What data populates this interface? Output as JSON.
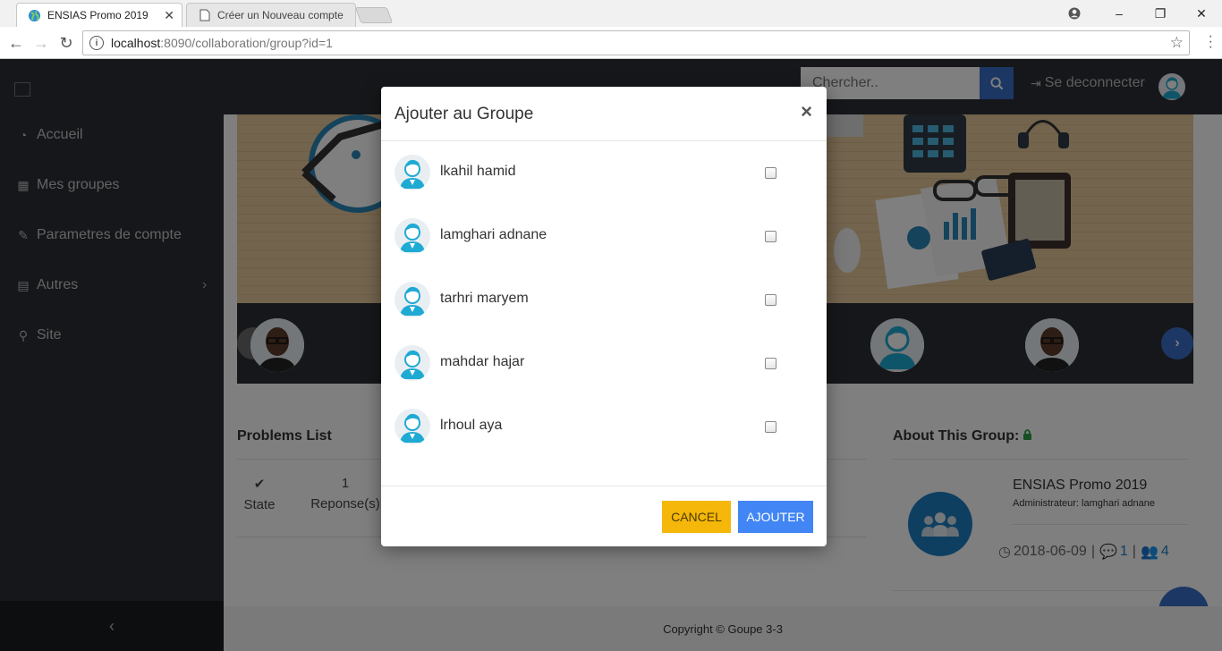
{
  "browser": {
    "tabs": [
      {
        "title": "ENSIAS Promo 2019",
        "active": true
      },
      {
        "title": "Créer un Nouveau compte",
        "active": false
      }
    ],
    "url_host": "localhost",
    "url_path": ":8090/collaboration/group?id=1"
  },
  "sidebar": {
    "items": [
      {
        "label": "Accueil",
        "icon": "dashboard-icon"
      },
      {
        "label": "Mes groupes",
        "icon": "table-icon"
      },
      {
        "label": "Parametres de compte",
        "icon": "wrench-icon"
      },
      {
        "label": "Autres",
        "icon": "file-icon"
      },
      {
        "label": "Site",
        "icon": "link-icon"
      }
    ],
    "collapse_glyph": "‹"
  },
  "topbar": {
    "search_placeholder": "Chercher..",
    "logout_label": "Se deconnecter"
  },
  "problems": {
    "title": "Problems List",
    "state_label": "State",
    "responses_value": "1",
    "responses_label": "Reponse(s)"
  },
  "about": {
    "title": "About This Group:",
    "group_name": "ENSIAS Promo 2019",
    "admin_line": "Administrateur: lamghari adnane",
    "date": "2018-06-09",
    "comments": "1",
    "members": "4"
  },
  "footer": {
    "copyright": "Copyright © Goupe 3-3"
  },
  "modal": {
    "title": "Ajouter au Groupe",
    "close_glyph": "×",
    "members": [
      {
        "name": "lkahil hamid",
        "checked": false
      },
      {
        "name": "lamghari adnane",
        "checked": false
      },
      {
        "name": "tarhri maryem",
        "checked": false
      },
      {
        "name": "mahdar hajar",
        "checked": false
      },
      {
        "name": "lrhoul aya",
        "checked": false
      }
    ],
    "cancel_label": "CANCEL",
    "add_label": "AJOUTER"
  },
  "colors": {
    "accent_blue": "#4285f4",
    "cancel_yellow": "#f5b70a",
    "sidebar_bg": "#2b2f34",
    "avatar_cyan": "#1eaad3"
  }
}
